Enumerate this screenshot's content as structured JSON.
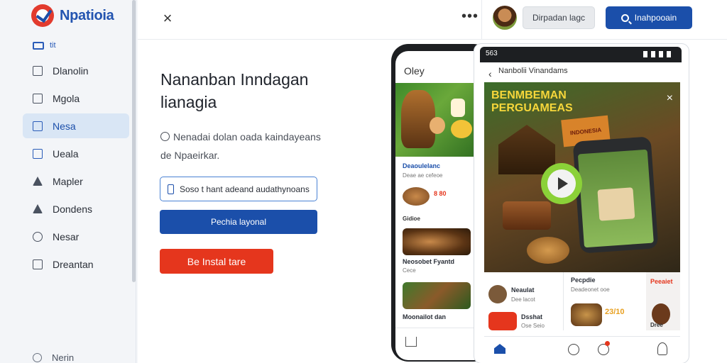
{
  "app": {
    "name": "Npatioia"
  },
  "sidebar": {
    "mini_label": "tit",
    "items": [
      {
        "label": "Dlanolin"
      },
      {
        "label": "Mgola"
      },
      {
        "label": "Nesa"
      },
      {
        "label": "Ueala"
      },
      {
        "label": "Mapler"
      },
      {
        "label": "Dondens"
      },
      {
        "label": "Nesar"
      },
      {
        "label": "Dreantan"
      }
    ],
    "active_index": 2,
    "bottom_label": "Nerin"
  },
  "topbar": {
    "close_glyph": "×",
    "more_glyph": "•••",
    "gray_button": "Dirpadan lagc",
    "blue_button": "Inahpooain"
  },
  "main": {
    "headline": "Nananban Inndagan lianagia",
    "sub_line1": "Nenadai dolan oada kaindayeans",
    "sub_line2": "de Npaeirkar.",
    "input_value": "Soso t hant adeand audathynoans",
    "primary_button": "Pechia layonal",
    "red_button": "Be Instal tare"
  },
  "phone_left": {
    "header": "Oley",
    "card1_title": "Deaoulelanc",
    "card1_sub": "Deae ae cefeoe",
    "price": "8 80",
    "row2": "Gidioe",
    "card2_title": "Neosobet Fyantd",
    "card2_sub": "Cece",
    "card3_title": "Moonailot dan"
  },
  "phone_right": {
    "status": "563",
    "back_title": "Nanbolii Vinandams",
    "banner_line1": "BENMBEMAN",
    "banner_line2": "PERGUAMEAS",
    "banner_badge": "INDONESIA",
    "card_a_title": "Neaulat",
    "card_a_sub": "Dee lacot",
    "card_b_title": "Dsshat",
    "card_b_sub": "Ose Seio",
    "mid_title": "Pecpdie",
    "mid_sub": "Deadeonet ooe",
    "mid_price": "23/10",
    "right_title": "Peeaiet",
    "right_sub": "Dree"
  },
  "colors": {
    "brand_blue": "#1b4faa",
    "accent_red": "#e5361d",
    "active_nav": "#d9e6f5"
  }
}
